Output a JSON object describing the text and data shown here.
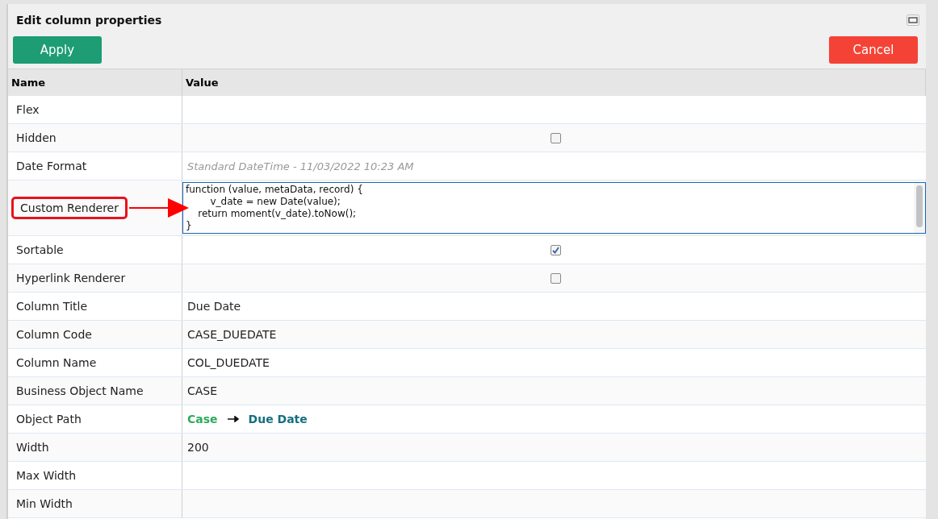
{
  "window": {
    "title": "Edit column properties"
  },
  "buttons": [
    {
      "kind": "apply",
      "label": "Apply"
    },
    {
      "kind": "cancel",
      "label": "Cancel"
    }
  ],
  "table": {
    "columns": [
      "Name",
      "Value"
    ],
    "rows": [
      {
        "name": "Flex",
        "kind": "text",
        "value": ""
      },
      {
        "name": "Hidden",
        "kind": "checkbox",
        "checked": false
      },
      {
        "name": "Date Format",
        "kind": "placeholder",
        "placeholder": "Standard DateTime - 11/03/2022 10:23 AM"
      },
      {
        "name": "Custom Renderer",
        "kind": "code",
        "annotated": true,
        "value": "function (value, metaData, record) {\n        v_date = new Date(value);\n    return moment(v_date).toNow();\n}"
      },
      {
        "name": "Sortable",
        "kind": "checkbox",
        "checked": true
      },
      {
        "name": "Hyperlink Renderer",
        "kind": "checkbox",
        "checked": false
      },
      {
        "name": "Column Title",
        "kind": "text",
        "value": "Due Date"
      },
      {
        "name": "Column Code",
        "kind": "text",
        "value": "CASE_DUEDATE"
      },
      {
        "name": "Column Name",
        "kind": "text",
        "value": "COL_DUEDATE"
      },
      {
        "name": "Business Object Name",
        "kind": "text",
        "value": "CASE"
      },
      {
        "name": "Object Path",
        "kind": "path",
        "from": "Case",
        "to": "Due Date"
      },
      {
        "name": "Width",
        "kind": "text",
        "value": "200"
      },
      {
        "name": "Max Width",
        "kind": "text",
        "value": ""
      },
      {
        "name": "Min Width",
        "kind": "text",
        "value": ""
      }
    ]
  }
}
